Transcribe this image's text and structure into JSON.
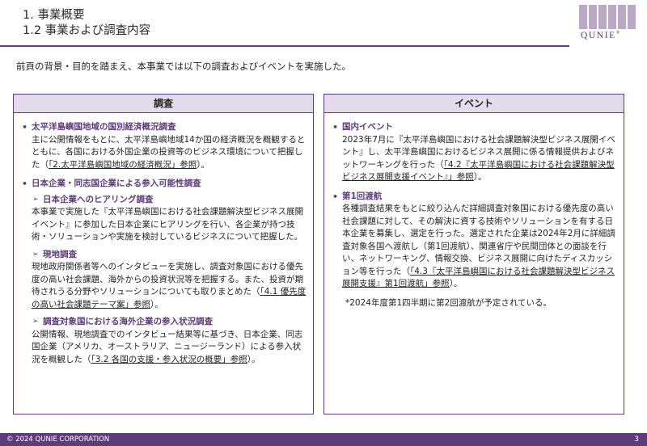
{
  "header": {
    "title_line1": "1. 事業概要",
    "title_line2": "1.2 事業および調査内容"
  },
  "logo": {
    "text": "QUNIE",
    "reg": "®"
  },
  "intro": "前頁の背景・目的を踏まえ、本事業では以下の調査およびイベントを実施した。",
  "left": {
    "heading": "調査",
    "items": [
      {
        "title": "太平洋島嶼国地域の国別経済概況調査",
        "text_a": "主に公開情報をもとに、太平洋島嶼地域14か国の経済概況を概観するとともに、各国における外国企業の投資等のビジネス環境について把握した（",
        "ref": "「2.太平洋島嶼国地域の経済概況」参照",
        "text_b": "）。"
      },
      {
        "title": "日本企業・同志国企業による参入可能性調査",
        "subs": [
          {
            "title": "日本企業へのヒアリング調査",
            "text_a": "本事業で実施した『太平洋島嶼国における社会課題解決型ビジネス展開イベント』に参加した日本企業にヒアリングを行い、各企業が持つ技術・ソリューションや実施を検討しているビジネスについて把握した。",
            "ref": "",
            "text_b": ""
          },
          {
            "title": "現地調査",
            "text_a": "現地政府関係者等へのインタビューを実施し、調査対象国における優先度の高い社会課題、海外からの投資状況等を把握する。また、投資が期待されうる分野やソリューションについても取りまとめた（",
            "ref": "「4.1 優先度の高い社会課題テーマ案」参照",
            "text_b": "）。"
          },
          {
            "title": "調査対象国における海外企業の参入状況調査",
            "text_a": "公開情報、現地調査でのインタビュー結果等に基づき、日本企業、同志国企業（アメリカ、オーストラリア、ニュージーランド）による参入状況を概観した（",
            "ref": "「3.2 各国の支援・参入状況の概要」参照",
            "text_b": "）。"
          }
        ]
      }
    ]
  },
  "right": {
    "heading": "イベント",
    "items": [
      {
        "title": "国内イベント",
        "text_a": "2023年7月に『太平洋島嶼国における社会課題解決型ビジネス展開イベント』し、太平洋島嶼国におけるビジネス展開に係る情報提供およびネットワーキングを行った（",
        "ref": "「4.2『太平洋島嶼国における社会課題解決型ビジネス展開支援イベント』」参照",
        "text_b": "）。"
      },
      {
        "title": "第1回渡航",
        "text_a": "各種調査結果をもとに絞り込んだ詳細調査対象国における優先度の高い社会課題に対して、その解決に資する技術やソリューションを有する日本企業を募集し、選定を行った。選定された企業は2024年2月に詳細調査対象各国へ渡航し（第1回渡航）、関連省庁や民間団体との面談を行い、ネットワーキング、情報交換、ビジネス展開に向けたディスカッション等を行った（",
        "ref": "「4.3『太平洋島嶼国における社会課題解決型ビジネス展開支援』第1回渡航」参照",
        "text_b": "）。"
      }
    ],
    "note": "*2024年度第1四半期に第2回渡航が予定されている。"
  },
  "footer": {
    "copyright": "© 2024  QUNIE CORPORATION",
    "page": "3"
  },
  "colors": {
    "accent": "#5e3b7a",
    "header_fill": "#e3dbea"
  }
}
